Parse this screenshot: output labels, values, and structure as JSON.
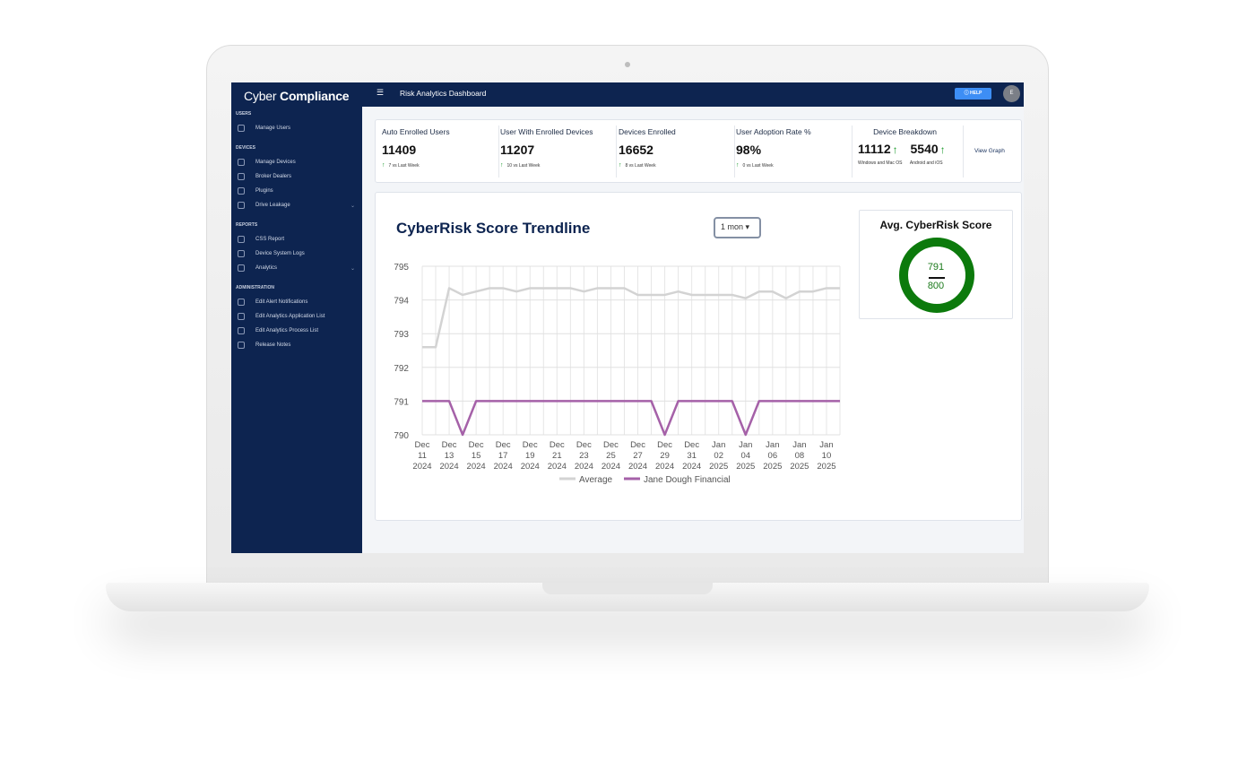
{
  "app": {
    "brand_light": "Cyber ",
    "brand_bold": "Compliance",
    "page_title": "Risk Analytics Dashboard",
    "menu_icon": "menu-icon",
    "help_label": "HELP",
    "avatar_initial": "E"
  },
  "sidebar": {
    "sections": [
      {
        "title": "USERS",
        "items": [
          {
            "label": "Manage Users",
            "icon": "users-icon"
          }
        ]
      },
      {
        "title": "DEVICES",
        "items": [
          {
            "label": "Manage Devices",
            "icon": "devices-icon"
          },
          {
            "label": "Broker Dealers",
            "icon": "broker-icon"
          },
          {
            "label": "Plugins",
            "icon": "plugins-icon"
          },
          {
            "label": "Drive Leakage",
            "icon": "drive-icon",
            "expandable": true
          }
        ]
      },
      {
        "title": "REPORTS",
        "items": [
          {
            "label": "CSS Report",
            "icon": "report-icon"
          },
          {
            "label": "Device System Logs",
            "icon": "logs-icon"
          },
          {
            "label": "Analytics",
            "icon": "analytics-icon",
            "expandable": true
          }
        ]
      },
      {
        "title": "ADMINISTRATION",
        "items": [
          {
            "label": "Edit Alert Notifications",
            "icon": "bell-icon"
          },
          {
            "label": "Edit Analytics Application List",
            "icon": "grid-icon"
          },
          {
            "label": "Edit Analytics Process List",
            "icon": "process-icon"
          },
          {
            "label": "Release Notes",
            "icon": "notes-icon"
          }
        ]
      }
    ]
  },
  "stats": [
    {
      "title": "Auto Enrolled Users",
      "value": "11409",
      "sub": "7 vs Last Week"
    },
    {
      "title": "User With Enrolled Devices",
      "value": "11207",
      "sub": "10 vs Last Week"
    },
    {
      "title": "Devices Enrolled",
      "value": "16652",
      "sub": "8 vs Last Week"
    },
    {
      "title": "User Adoption Rate %",
      "value": "98%",
      "sub": "0 vs Last Week"
    }
  ],
  "breakdown": {
    "title": "Device Breakdown",
    "value_a": "11112",
    "label_a": "Windows and Mac OS",
    "value_b": "5540",
    "label_b": "Android and iOS",
    "view_graph": "View Graph"
  },
  "trend": {
    "title": "CyberRisk Score Trendline",
    "range": "1 mon ▾"
  },
  "score": {
    "title": "Avg. CyberRisk Score",
    "value": "791",
    "max": "800",
    "ring_color": "#0c7a0c"
  },
  "colors": {
    "navy": "#0d2450",
    "up_arrow": "#1a9a2a",
    "average_line": "#d3d3d3",
    "company_line": "#a561a8"
  },
  "chart_data": {
    "type": "line",
    "title": "CyberRisk Score Trendline",
    "ylim": [
      790,
      795
    ],
    "yticks": [
      790,
      791,
      792,
      793,
      794,
      795
    ],
    "x_tick_labels": [
      [
        "Dec",
        "11",
        "2024"
      ],
      [
        "Dec",
        "13",
        "2024"
      ],
      [
        "Dec",
        "15",
        "2024"
      ],
      [
        "Dec",
        "17",
        "2024"
      ],
      [
        "Dec",
        "19",
        "2024"
      ],
      [
        "Dec",
        "21",
        "2024"
      ],
      [
        "Dec",
        "23",
        "2024"
      ],
      [
        "Dec",
        "25",
        "2024"
      ],
      [
        "Dec",
        "27",
        "2024"
      ],
      [
        "Dec",
        "29",
        "2024"
      ],
      [
        "Dec",
        "31",
        "2024"
      ],
      [
        "Jan",
        "02",
        "2025"
      ],
      [
        "Jan",
        "04",
        "2025"
      ],
      [
        "Jan",
        "06",
        "2025"
      ],
      [
        "Jan",
        "08",
        "2025"
      ],
      [
        "Jan",
        "10",
        "2025"
      ]
    ],
    "x": [
      "2024-12-11",
      "2024-12-12",
      "2024-12-13",
      "2024-12-14",
      "2024-12-15",
      "2024-12-16",
      "2024-12-17",
      "2024-12-18",
      "2024-12-19",
      "2024-12-20",
      "2024-12-21",
      "2024-12-22",
      "2024-12-23",
      "2024-12-24",
      "2024-12-25",
      "2024-12-26",
      "2024-12-27",
      "2024-12-28",
      "2024-12-29",
      "2024-12-30",
      "2024-12-31",
      "2025-01-01",
      "2025-01-02",
      "2025-01-03",
      "2025-01-04",
      "2025-01-05",
      "2025-01-06",
      "2025-01-07",
      "2025-01-08",
      "2025-01-09",
      "2025-01-10",
      "2025-01-11"
    ],
    "series": [
      {
        "name": "Average",
        "color": "#d3d3d3",
        "values": [
          792.6,
          792.6,
          794.35,
          794.15,
          794.25,
          794.35,
          794.35,
          794.25,
          794.35,
          794.35,
          794.35,
          794.35,
          794.25,
          794.35,
          794.35,
          794.35,
          794.15,
          794.15,
          794.15,
          794.25,
          794.15,
          794.15,
          794.15,
          794.15,
          794.05,
          794.25,
          794.25,
          794.05,
          794.25,
          794.25,
          794.35,
          794.35
        ]
      },
      {
        "name": "Jane Dough Financial",
        "color": "#a561a8",
        "values": [
          791,
          791,
          791,
          790,
          791,
          791,
          791,
          791,
          791,
          791,
          791,
          791,
          791,
          791,
          791,
          791,
          791,
          791,
          790,
          791,
          791,
          791,
          791,
          791,
          790,
          791,
          791,
          791,
          791,
          791,
          791,
          791
        ]
      }
    ],
    "legend": "bottom",
    "grid": true
  }
}
